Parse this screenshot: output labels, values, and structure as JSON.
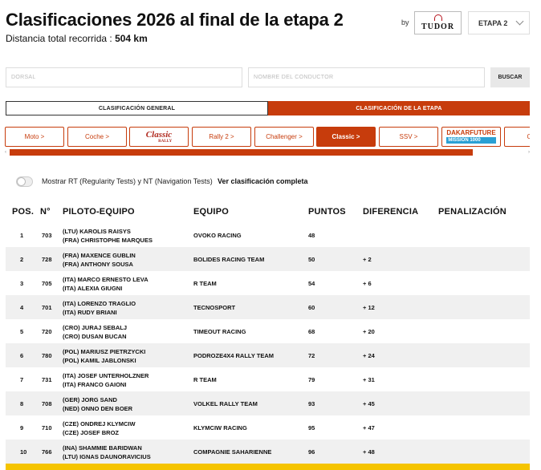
{
  "header": {
    "title": "Clasificaciones 2026 al final de la etapa 2",
    "distance_label": "Distancia total recorrida :",
    "distance_value": "504 km",
    "sponsor_by": "by",
    "sponsor_name": "TUDOR",
    "stage_select": "ETAPA 2"
  },
  "search": {
    "dorsal_placeholder": "DORSAL",
    "driver_placeholder": "NOMBRE DEL CONDUCTOR",
    "button_label": "BUSCAR"
  },
  "class_tabs": [
    {
      "label": "CLASIFICACIÓN GENERAL",
      "active": false
    },
    {
      "label": "CLASIFICACIÓN DE LA ETAPA",
      "active": true
    }
  ],
  "categories": [
    {
      "label": "Moto >",
      "active": false
    },
    {
      "label": "Coche >",
      "active": false
    },
    {
      "label": "Classic",
      "logo_sub": "RALLY",
      "active": false
    },
    {
      "label": "Rally 2 >",
      "active": false
    },
    {
      "label": "Challenger >",
      "active": false
    },
    {
      "label": "Classic >",
      "active": true
    },
    {
      "label": "SSV >",
      "active": false
    },
    {
      "label": "DAKARFUTURE",
      "logo_sub": "MISSION 1000",
      "active": false
    },
    {
      "label": "Cam",
      "active": false
    }
  ],
  "options": {
    "toggle_label": "Mostrar RT (Regularity Tests) y NT (Navigation Tests)",
    "full_link": "Ver clasificación completa"
  },
  "table": {
    "headers": {
      "pos": "POS.",
      "num": "N°",
      "pilot": "PILOTO-EQUIPO",
      "team": "EQUIPO",
      "points": "PUNTOS",
      "diff": "DIFERENCIA",
      "penalty": "PENALIZACIÓN"
    },
    "rows": [
      {
        "pos": "1",
        "num": "703",
        "p1": "(LTU)  KAROLIS RAISYS",
        "p2": "(FRA)  CHRISTOPHE MARQUES",
        "team": "OVOKO RACING",
        "points": "48",
        "diff": ""
      },
      {
        "pos": "2",
        "num": "728",
        "p1": "(FRA)  MAXENCE GUBLIN",
        "p2": "(FRA)  ANTHONY SOUSA",
        "team": "BOLIDES RACING TEAM",
        "points": "50",
        "diff": "+ 2"
      },
      {
        "pos": "3",
        "num": "705",
        "p1": "(ITA)  MARCO ERNESTO LEVA",
        "p2": "(ITA)  ALEXIA GIUGNI",
        "team": "R TEAM",
        "points": "54",
        "diff": "+ 6"
      },
      {
        "pos": "4",
        "num": "701",
        "p1": "(ITA)  LORENZO TRAGLIO",
        "p2": "(ITA)  RUDY BRIANI",
        "team": "TECNOSPORT",
        "points": "60",
        "diff": "+ 12"
      },
      {
        "pos": "5",
        "num": "720",
        "p1": "(CRO)  JURAJ SEBALJ",
        "p2": "(CRO)  DUSAN BUCAN",
        "team": "TIMEOUT RACING",
        "points": "68",
        "diff": "+ 20"
      },
      {
        "pos": "6",
        "num": "780",
        "p1": "(POL)  MARIUSZ PIETRZYCKI",
        "p2": "(POL)  KAMIL JABLONSKI",
        "team": "PODROZE4X4 RALLY TEAM",
        "points": "72",
        "diff": "+ 24"
      },
      {
        "pos": "7",
        "num": "731",
        "p1": "(ITA)  JOSEF UNTERHOLZNER",
        "p2": "(ITA)  FRANCO GAIONI",
        "team": "R TEAM",
        "points": "79",
        "diff": "+ 31"
      },
      {
        "pos": "8",
        "num": "708",
        "p1": "(GER)  JORG SAND",
        "p2": "(NED)  ONNO DEN BOER",
        "team": "VOLKEL RALLY TEAM",
        "points": "93",
        "diff": "+ 45"
      },
      {
        "pos": "9",
        "num": "710",
        "p1": "(CZE)  ONDREJ KLYMCIW",
        "p2": "(CZE)  JOSEF BROZ",
        "team": "KLYMCIW RACING",
        "points": "95",
        "diff": "+ 47"
      },
      {
        "pos": "10",
        "num": "766",
        "p1": "(INA)  SHAMMIE BARIDWAN",
        "p2": "(LTU)  IGNAS DAUNORAVICIUS",
        "team": "COMPAGNIE SAHARIENNE",
        "points": "96",
        "diff": "+ 48"
      }
    ]
  },
  "colors": {
    "accent": "#c73c0c",
    "row_alt": "#f0f0f0",
    "highlight_bar": "#f5c400"
  }
}
